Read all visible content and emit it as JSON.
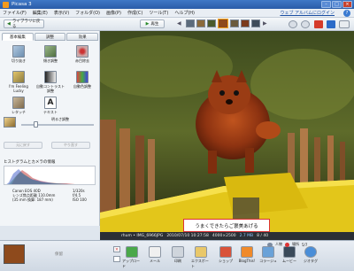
{
  "window": {
    "title": "Picasa 3",
    "controls": [
      "–",
      "□",
      "×"
    ]
  },
  "menu": {
    "items": [
      "ファイル(F)",
      "編集(E)",
      "表示(V)",
      "フォルダ(O)",
      "画像(P)",
      "作成(C)",
      "ツール(T)",
      "ヘルプ(H)"
    ],
    "account_link": "ウェブ アルバムにログイン",
    "help_icon": "?"
  },
  "toolbar": {
    "back_label": "ライブラリに戻る",
    "play_label": "再生",
    "play_icon": "play-icon",
    "left_arrow": "◀",
    "right_arrow": "▶"
  },
  "edit_panel": {
    "tabs": [
      "基本編集",
      "調整",
      "効果"
    ],
    "effects": [
      {
        "label": "切り抜き"
      },
      {
        "label": "傾き調整"
      },
      {
        "label": "赤目除去"
      },
      {
        "label": "I'm Feeling Lucky"
      },
      {
        "label": "自動コントラスト調整"
      },
      {
        "label": "自動色調整"
      },
      {
        "label": "レタッチ"
      },
      {
        "label": "テキスト"
      },
      {
        "label": "明るさ調整"
      }
    ],
    "undo_label": "元に戻す",
    "redo_label": "やり直す",
    "histogram_title": "ヒストグラムとカメラの情報",
    "camera_info": {
      "model": "Canon EOS 40D",
      "lens": "レンズ焦点距離 110.0mm",
      "equiv": "(35 mm 換算: 187 mm)",
      "shutter": "1/320s",
      "fnumber": "f/4.5",
      "iso": "ISO 100"
    }
  },
  "photo": {
    "caption": "うまくできたらご褒美あげる"
  },
  "status": {
    "filename": "rhum • IMG_6966JPG",
    "date": "2010/07/10 10:27:58",
    "dimensions": "4000×2500",
    "filesize": "2.7 MB",
    "index": "8 / 40"
  },
  "tray": {
    "hold_label": "保留",
    "icons": [
      "アップロード",
      "メール",
      "印刷",
      "エクスポート",
      "ショップ",
      "BlogThis!",
      "コラージュ",
      "ムービー",
      "ジオタグ"
    ],
    "people_label": "人物",
    "location_label": "場所",
    "count": "5/7"
  }
}
